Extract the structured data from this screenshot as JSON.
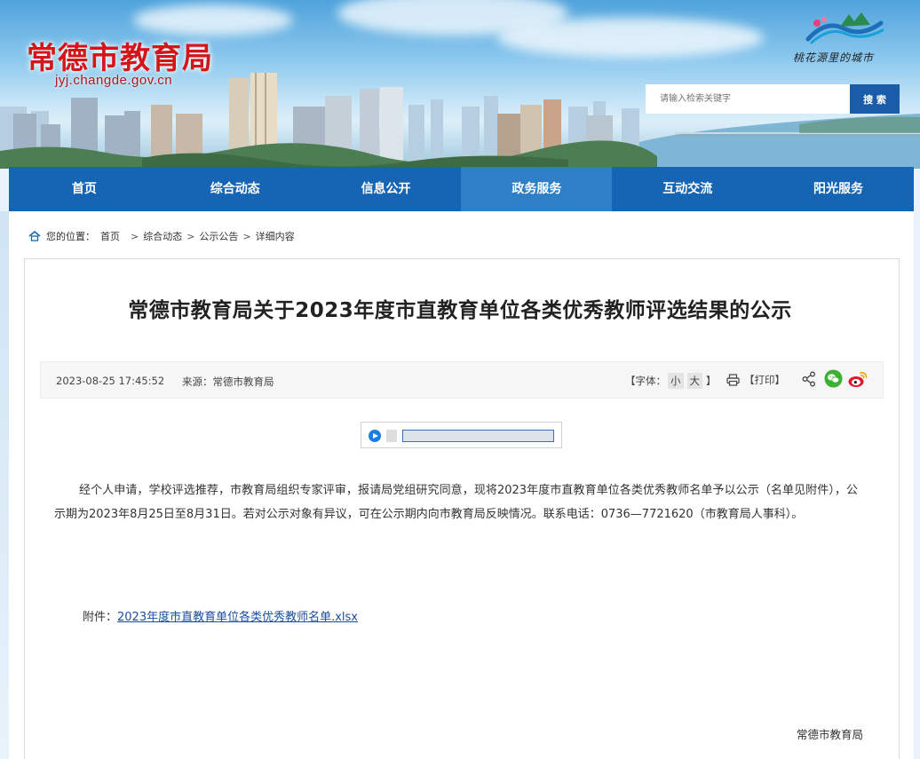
{
  "header": {
    "site_title": "常德市教育局",
    "site_domain": "jyj.changde.gov.cn",
    "slogan": "桃花源里的城市",
    "search": {
      "placeholder": "请输入检索关键字",
      "button": "搜 索"
    }
  },
  "nav": {
    "items": [
      {
        "label": "首页",
        "active": false
      },
      {
        "label": "综合动态",
        "active": false
      },
      {
        "label": "信息公开",
        "active": false
      },
      {
        "label": "政务服务",
        "active": true
      },
      {
        "label": "互动交流",
        "active": false
      },
      {
        "label": "阳光服务",
        "active": false
      }
    ]
  },
  "breadcrumb": {
    "prefix": "您的位置：",
    "items": [
      "首页",
      "综合动态",
      "公示公告",
      "详细内容"
    ],
    "separator": ">"
  },
  "article": {
    "title": "常德市教育局关于2023年度市直教育单位各类优秀教师评选结果的公示",
    "date": "2023-08-25 17:45:52",
    "source": "来源：常德市教育局",
    "font_label_open": "【字体：",
    "font_small": "小",
    "font_large": "大",
    "font_label_close": "】",
    "print": "【打印】",
    "body": "经个人申请，学校评选推荐，市教育局组织专家评审，报请局党组研究同意，现将2023年度市直教育单位各类优秀教师名单予以公示（名单见附件），公示期为2023年8月25日至8月31日。若对公示对象有异议，可在公示期内向市教育局反映情况。联系电话：0736—7721620（市教育局人事科）。",
    "attachment_label": "附件：",
    "attachment_link": "2023年度市直教育单位各类优秀教师名单.xlsx",
    "signature": "常德市教育局"
  },
  "colors": {
    "title_red": "#d4161b",
    "nav_blue": "#1665b4",
    "nav_active": "#2f7fc6",
    "search_button": "#1a5ca8",
    "link": "#1a4fa0"
  },
  "icons": [
    "home-icon",
    "print-icon",
    "share-icon",
    "wechat-icon",
    "weibo-icon",
    "play-icon",
    "stop-icon"
  ]
}
